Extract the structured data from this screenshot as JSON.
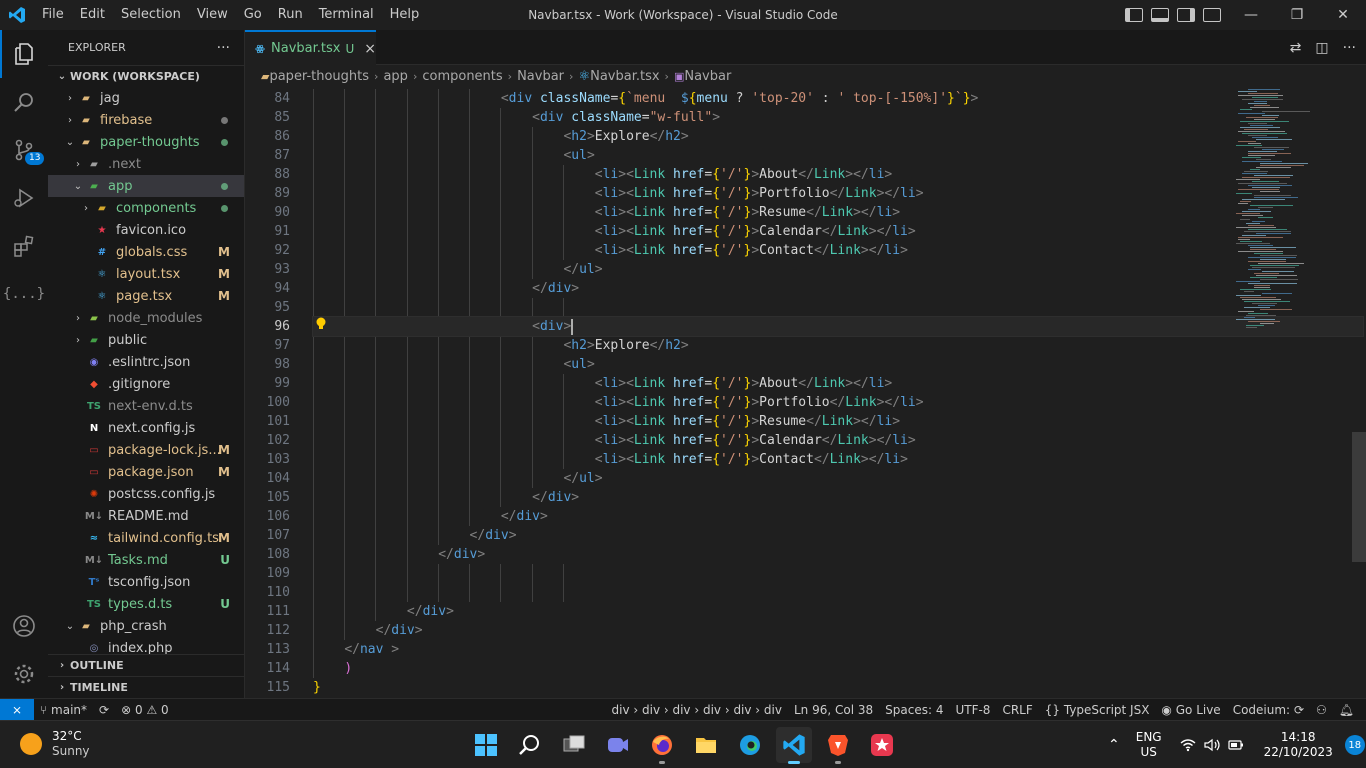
{
  "titlebar": {
    "menus": [
      "File",
      "Edit",
      "Selection",
      "View",
      "Go",
      "Run",
      "Terminal",
      "Help"
    ],
    "title": "Navbar.tsx - Work (Workspace) - Visual Studio Code"
  },
  "activity": {
    "source_control_badge": "13"
  },
  "explorer": {
    "header": "EXPLORER",
    "more": "···",
    "workspace": "WORK (WORKSPACE)",
    "items": [
      {
        "label": "jag",
        "indent": 1,
        "kind": "folder",
        "open": false,
        "color": "#cccccc",
        "icon": "folder-icon"
      },
      {
        "label": "firebase",
        "indent": 1,
        "kind": "folder",
        "open": false,
        "color": "#e2c08d",
        "icon": "folder-icon",
        "dot": "#a0a0a0"
      },
      {
        "label": "paper-thoughts",
        "indent": 1,
        "kind": "folder",
        "open": true,
        "color": "#73c991",
        "icon": "folder-open-icon",
        "dot": "#73c991"
      },
      {
        "label": ".next",
        "indent": 2,
        "kind": "folder",
        "open": false,
        "color": "#8b8b8b",
        "icon": "next-folder-icon"
      },
      {
        "label": "app",
        "indent": 2,
        "kind": "folder",
        "open": true,
        "color": "#73c991",
        "icon": "app-folder-icon",
        "dot": "#73c991",
        "selected": true
      },
      {
        "label": "components",
        "indent": 3,
        "kind": "folder",
        "open": false,
        "color": "#73c991",
        "icon": "components-folder-icon",
        "dot": "#73c991"
      },
      {
        "label": "favicon.ico",
        "indent": 3,
        "kind": "file",
        "color": "#cccccc",
        "icon": "favicon-icon"
      },
      {
        "label": "globals.css",
        "indent": 3,
        "kind": "file",
        "color": "#e2c08d",
        "icon": "css-icon",
        "badge": "M"
      },
      {
        "label": "layout.tsx",
        "indent": 3,
        "kind": "file",
        "color": "#e2c08d",
        "icon": "react-icon",
        "badge": "M"
      },
      {
        "label": "page.tsx",
        "indent": 3,
        "kind": "file",
        "color": "#e2c08d",
        "icon": "react-icon",
        "badge": "M"
      },
      {
        "label": "node_modules",
        "indent": 2,
        "kind": "folder",
        "open": false,
        "color": "#8b8b8b",
        "icon": "node-folder-icon"
      },
      {
        "label": "public",
        "indent": 2,
        "kind": "folder",
        "open": false,
        "color": "#cccccc",
        "icon": "public-folder-icon"
      },
      {
        "label": ".eslintrc.json",
        "indent": 2,
        "kind": "file",
        "color": "#cccccc",
        "icon": "eslint-icon"
      },
      {
        "label": ".gitignore",
        "indent": 2,
        "kind": "file",
        "color": "#cccccc",
        "icon": "git-icon"
      },
      {
        "label": "next-env.d.ts",
        "indent": 2,
        "kind": "file",
        "color": "#8b8b8b",
        "icon": "ts-icon"
      },
      {
        "label": "next.config.js",
        "indent": 2,
        "kind": "file",
        "color": "#cccccc",
        "icon": "next-icon"
      },
      {
        "label": "package-lock.js...",
        "indent": 2,
        "kind": "file",
        "color": "#e2c08d",
        "icon": "npm-icon",
        "badge": "M"
      },
      {
        "label": "package.json",
        "indent": 2,
        "kind": "file",
        "color": "#e2c08d",
        "icon": "npm-icon",
        "badge": "M"
      },
      {
        "label": "postcss.config.js",
        "indent": 2,
        "kind": "file",
        "color": "#cccccc",
        "icon": "postcss-icon"
      },
      {
        "label": "README.md",
        "indent": 2,
        "kind": "file",
        "color": "#cccccc",
        "icon": "markdown-icon"
      },
      {
        "label": "tailwind.config.ts",
        "indent": 2,
        "kind": "file",
        "color": "#e2c08d",
        "icon": "tailwind-icon",
        "badge": "M"
      },
      {
        "label": "Tasks.md",
        "indent": 2,
        "kind": "file",
        "color": "#73c991",
        "icon": "markdown-icon",
        "badge": "U"
      },
      {
        "label": "tsconfig.json",
        "indent": 2,
        "kind": "file",
        "color": "#cccccc",
        "icon": "tsconfig-icon"
      },
      {
        "label": "types.d.ts",
        "indent": 2,
        "kind": "file",
        "color": "#73c991",
        "icon": "ts-icon",
        "badge": "U"
      },
      {
        "label": "php_crash",
        "indent": 1,
        "kind": "folder",
        "open": true,
        "color": "#cccccc",
        "icon": "folder-open-icon"
      },
      {
        "label": "index.php",
        "indent": 2,
        "kind": "file",
        "color": "#cccccc",
        "icon": "php-icon"
      }
    ],
    "outline": "OUTLINE",
    "timeline": "TIMELINE"
  },
  "tab": {
    "name": "Navbar.tsx",
    "status": "U",
    "close": "×"
  },
  "breadcrumb": [
    "paper-thoughts",
    "app",
    "components",
    "Navbar",
    "Navbar.tsx",
    "Navbar"
  ],
  "editor": {
    "first_line": 84,
    "current_line": 96,
    "lines": [
      "                        <div className={`menu  ${menu ? 'top-20' : ' top-[-150%]'}`}>",
      "                            <div className=\"w-full\">",
      "                                <h2>Explore</h2>",
      "                                <ul>",
      "                                    <li><Link href={'/'}>About</Link></li>",
      "                                    <li><Link href={'/'}>Portfolio</Link></li>",
      "                                    <li><Link href={'/'}>Resume</Link></li>",
      "                                    <li><Link href={'/'}>Calendar</Link></li>",
      "                                    <li><Link href={'/'}>Contact</Link></li>",
      "                                </ul>",
      "                            </div>",
      "",
      "                            <div>",
      "                                <h2>Explore</h2>",
      "                                <ul>",
      "                                    <li><Link href={'/'}>About</Link></li>",
      "                                    <li><Link href={'/'}>Portfolio</Link></li>",
      "                                    <li><Link href={'/'}>Resume</Link></li>",
      "                                    <li><Link href={'/'}>Calendar</Link></li>",
      "                                    <li><Link href={'/'}>Contact</Link></li>",
      "                                </ul>",
      "                            </div>",
      "                        </div>",
      "                    </div>",
      "                </div>",
      "",
      "",
      "            </div>",
      "        </div>",
      "    </nav >",
      "    )",
      "}"
    ]
  },
  "status": {
    "branch": "main*",
    "errors": "0",
    "warnings": "0",
    "path": "div › div › div › div › div › div",
    "position": "Ln 96, Col 38",
    "spaces": "Spaces: 4",
    "encoding": "UTF-8",
    "eol": "CRLF",
    "language": "TypeScript JSX",
    "golive": "Go Live",
    "codeium": "Codeium:"
  },
  "taskbar": {
    "temp": "32°C",
    "weather": "Sunny",
    "lang1": "ENG",
    "lang2": "US",
    "time": "14:18",
    "date": "22/10/2023",
    "notifications": "18"
  }
}
